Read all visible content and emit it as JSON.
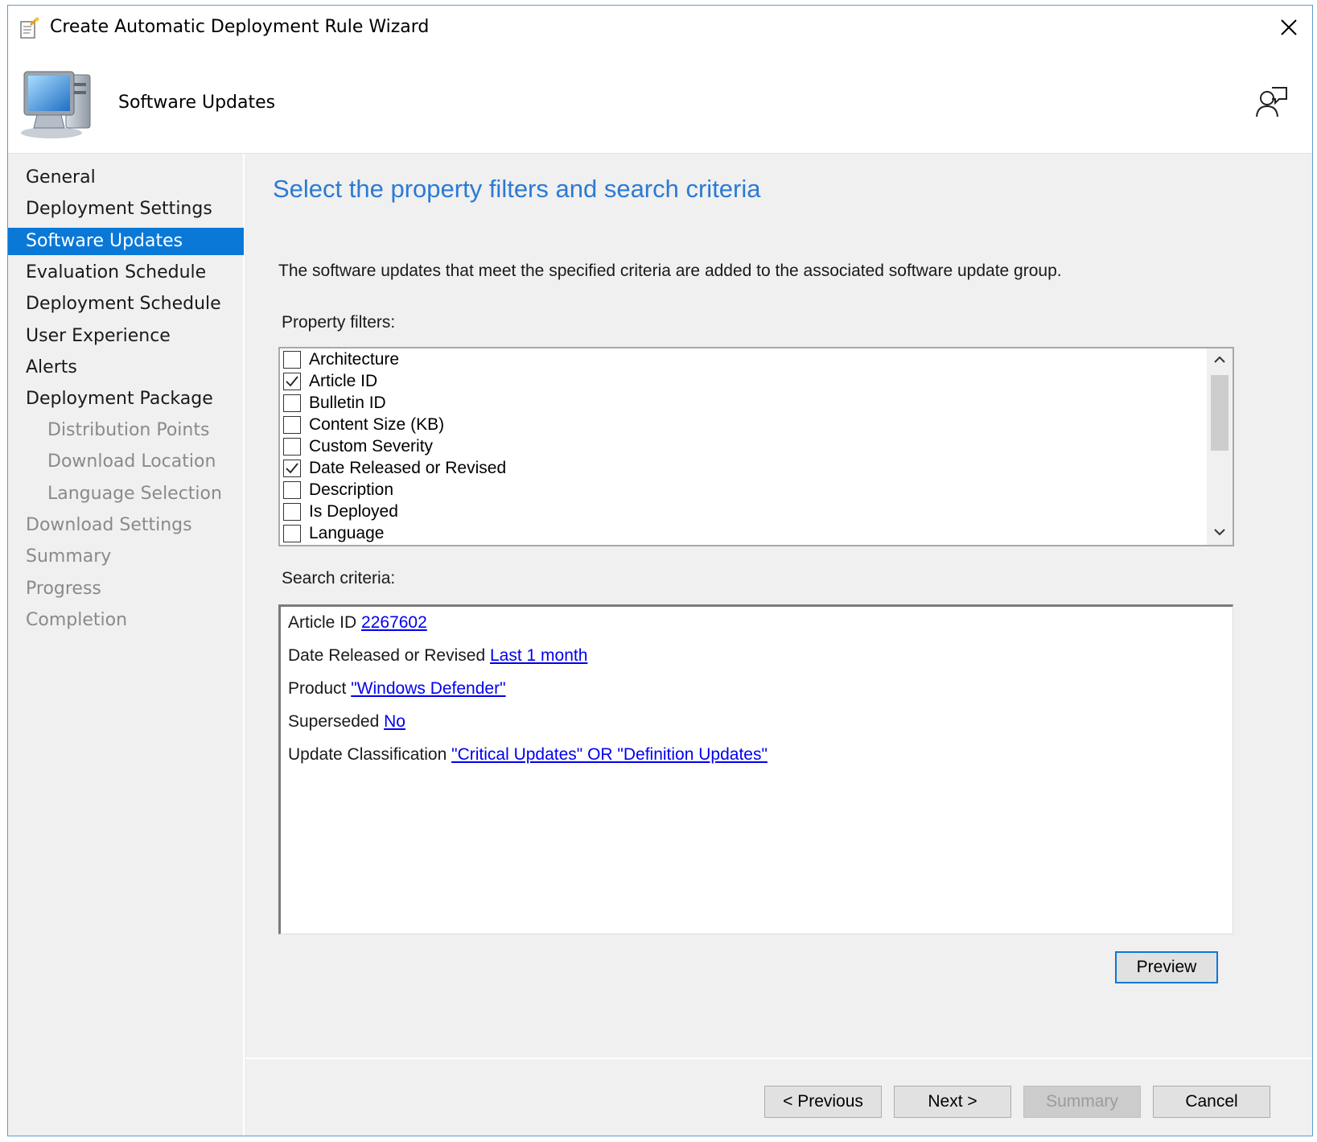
{
  "window": {
    "title": "Create Automatic Deployment Rule Wizard"
  },
  "header": {
    "title": "Software Updates"
  },
  "sidebar": {
    "items": [
      {
        "label": "General"
      },
      {
        "label": "Deployment Settings"
      },
      {
        "label": "Software Updates"
      },
      {
        "label": "Evaluation Schedule"
      },
      {
        "label": "Deployment Schedule"
      },
      {
        "label": "User Experience"
      },
      {
        "label": "Alerts"
      },
      {
        "label": "Deployment Package"
      },
      {
        "label": "Distribution Points"
      },
      {
        "label": "Download Location"
      },
      {
        "label": "Language Selection"
      },
      {
        "label": "Download Settings"
      },
      {
        "label": "Summary"
      },
      {
        "label": "Progress"
      },
      {
        "label": "Completion"
      }
    ]
  },
  "main": {
    "heading": "Select the property filters and search criteria",
    "description": "The software updates that meet the specified criteria are added to the associated software update group.",
    "property_filters_label": "Property filters:",
    "property_filters": [
      {
        "label": "Architecture",
        "checked": false
      },
      {
        "label": "Article ID",
        "checked": true
      },
      {
        "label": "Bulletin ID",
        "checked": false
      },
      {
        "label": "Content Size (KB)",
        "checked": false
      },
      {
        "label": "Custom Severity",
        "checked": false
      },
      {
        "label": "Date Released or Revised",
        "checked": true
      },
      {
        "label": "Description",
        "checked": false
      },
      {
        "label": "Is Deployed",
        "checked": false
      },
      {
        "label": "Language",
        "checked": false
      }
    ],
    "search_criteria_label": "Search criteria:",
    "search_criteria": [
      {
        "prefix": "Article ID",
        "value": "2267602"
      },
      {
        "prefix": "Date Released or Revised",
        "value": "Last 1 month"
      },
      {
        "prefix": "Product",
        "value": "\"Windows Defender\""
      },
      {
        "prefix": "Superseded",
        "value": "No"
      },
      {
        "prefix": "Update Classification",
        "value": "\"Critical Updates\" OR \"Definition Updates\""
      }
    ],
    "preview_label": "Preview"
  },
  "footer": {
    "previous_label": "< Previous",
    "next_label": "Next >",
    "summary_label": "Summary",
    "cancel_label": "Cancel"
  },
  "colors": {
    "accent": "#0a78d7",
    "heading": "#2a7ad5",
    "link": "#0000ee"
  }
}
